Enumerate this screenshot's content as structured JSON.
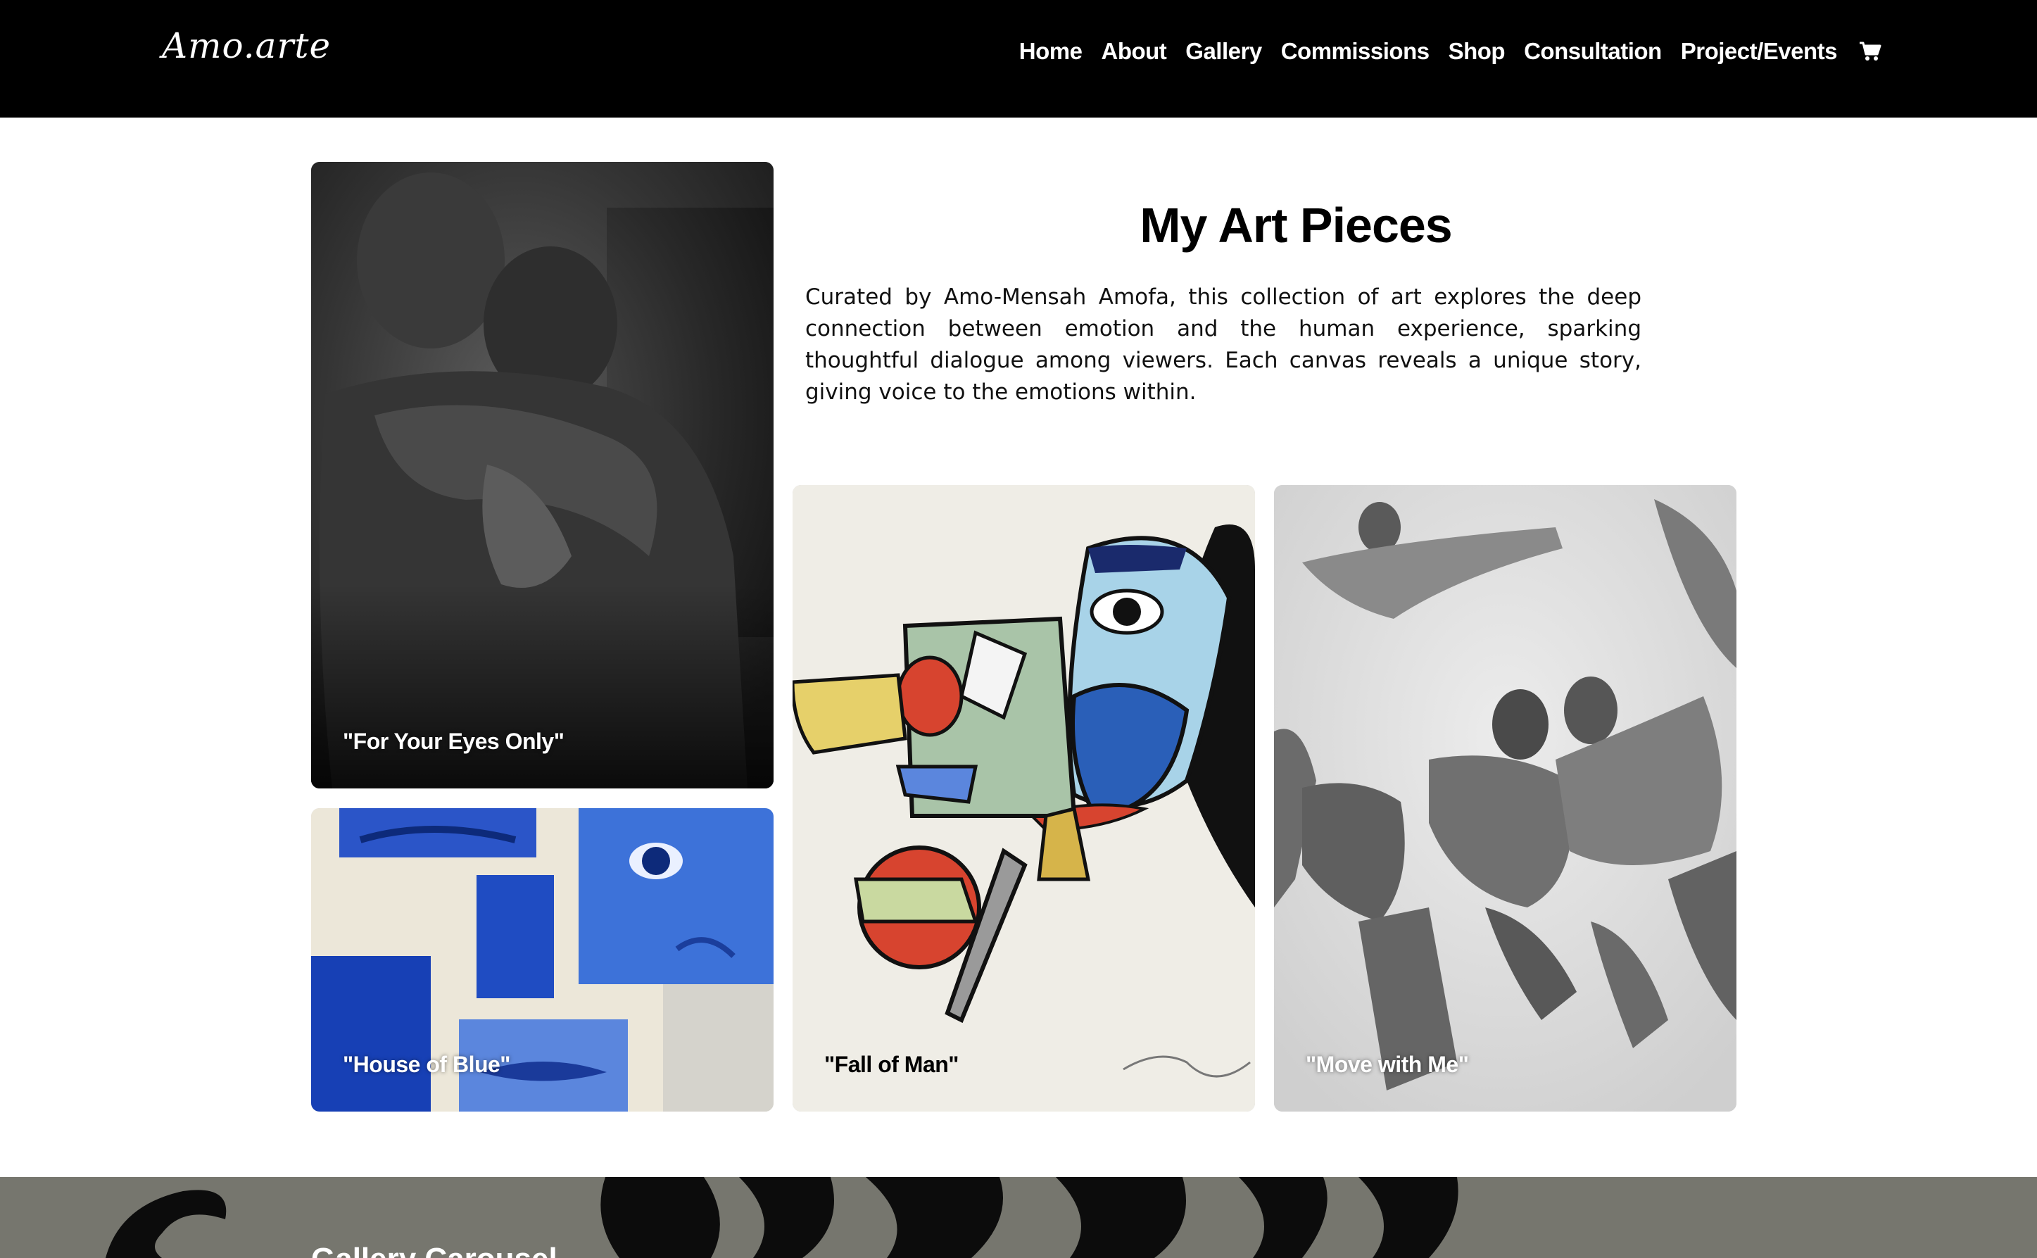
{
  "brand": {
    "logo": "Amo.arte"
  },
  "nav": {
    "home": "Home",
    "about": "About",
    "gallery": "Gallery",
    "commissions": "Commissions",
    "shop": "Shop",
    "consultation": "Consultation",
    "projects": "Project/Events",
    "cart_icon": "cart-icon"
  },
  "intro": {
    "title": "My Art Pieces",
    "description": "Curated by Amo-Mensah Amofa, this collection of art explores the deep connection between emotion and the human experience, sparking thoughtful dialogue among viewers. Each canvas reveals a unique story, giving voice to the emotions within."
  },
  "artworks": [
    {
      "title": "\"For Your Eyes Only\""
    },
    {
      "title": "\"House of Blue\""
    },
    {
      "title": "\"Fall of Man\""
    },
    {
      "title": "\"Move with Me\""
    }
  ],
  "carousel": {
    "title": "Gallery Carousel"
  },
  "colors": {
    "header_bg": "#000000",
    "carousel_bg": "#76766e"
  }
}
